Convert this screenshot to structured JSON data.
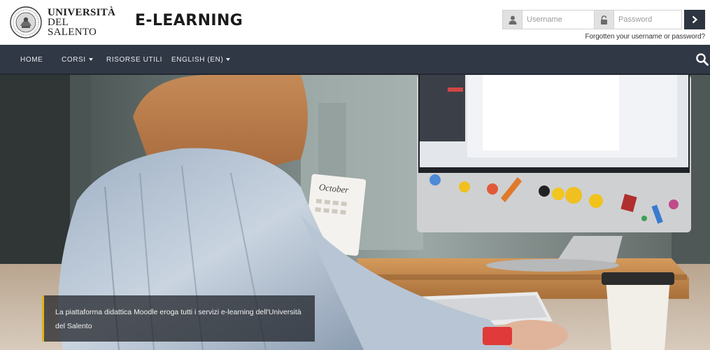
{
  "header": {
    "logo_line1": "UNIVERSITÀ",
    "logo_line2": "DEL SALENTO",
    "site_title": "E-LEARNING"
  },
  "login": {
    "username_placeholder": "Username",
    "password_placeholder": "Password",
    "user_icon": "user-icon",
    "lock_icon": "lock-icon",
    "submit_icon": "chevron-right-icon",
    "forgot_link": "Forgotten your username or password?"
  },
  "nav": {
    "items": [
      {
        "label": "HOME",
        "dropdown": false
      },
      {
        "label": "CORSI",
        "dropdown": true
      },
      {
        "label": "RISORSE UTILI",
        "dropdown": false
      },
      {
        "label": "ENGLISH (EN)",
        "dropdown": true
      }
    ],
    "search_icon": "search-icon"
  },
  "hero": {
    "caption": "La piattaforma didattica Moodle eroga tutti i servizi e-learning dell'Università del Salento",
    "notebook_text": "October"
  },
  "colors": {
    "navbar": "#313845",
    "accent": "#e2b21c",
    "login_button": "#2d3541"
  }
}
